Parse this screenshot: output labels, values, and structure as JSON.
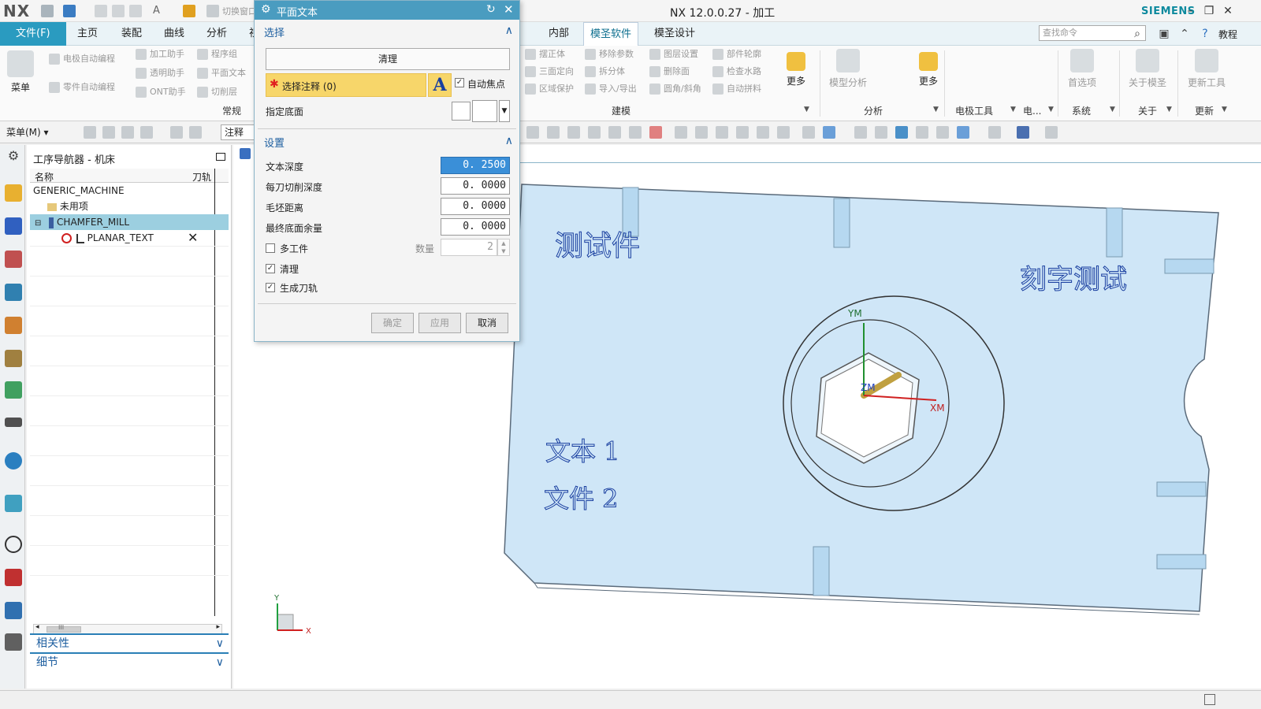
{
  "app": {
    "logo": "NX",
    "title": "NX 12.0.0.27 - 加工",
    "brand": "SIEMENS"
  },
  "quick_access": {
    "switch_window_label": "切换窗口"
  },
  "tabs": {
    "file": "文件(F)",
    "items": [
      "主页",
      "装配",
      "曲线",
      "分析",
      "视"
    ],
    "right_items": [
      "内部",
      "模圣软件",
      "模圣设计"
    ],
    "active": "模圣软件"
  },
  "search": {
    "placeholder": "查找命令"
  },
  "help_label": "教程",
  "ribbon": {
    "menu_big": "菜单",
    "group1": {
      "items": [
        "电极自动编程",
        "加工助手",
        "程序组",
        "透明助手",
        "平面文本",
        "零件自动编程",
        "ONT助手",
        "切削层"
      ],
      "label": "常规"
    },
    "group2": {
      "items": [
        "摆正体",
        "移除参数",
        "图层设置",
        "部件轮廓",
        "三面定向",
        "拆分体",
        "删除面",
        "检查水路",
        "区域保护",
        "导入/导出",
        "圆角/斜角",
        "自动拼料"
      ],
      "more": "更多",
      "label": "建模"
    },
    "group3": {
      "big": "模型分析",
      "more": "更多",
      "label": "分析"
    },
    "group4": {
      "label": "电极工具"
    },
    "group5": {
      "label": "电..."
    },
    "group6": {
      "big": "首选项",
      "label": "系统"
    },
    "group7": {
      "big": "关于模圣",
      "label": "关于"
    },
    "group8": {
      "big": "更新工具",
      "label": "更新"
    }
  },
  "toolbar2": {
    "menu_label": "菜单(M)",
    "filter_value": "注释"
  },
  "navigator": {
    "title": "工序导航器 - 机床",
    "col_name": "名称",
    "col_path": "刀轨",
    "rows": [
      {
        "label": "GENERIC_MACHINE",
        "selected": false
      },
      {
        "label": "未用项",
        "selected": false
      },
      {
        "label": "CHAMFER_MILL",
        "selected": true
      },
      {
        "label": "PLANAR_TEXT",
        "selected": false,
        "path_status": "✕"
      }
    ],
    "scroll_grip": "III",
    "accordion": [
      "相关性",
      "细节"
    ]
  },
  "dialog": {
    "title": "平面文本",
    "section_select": "选择",
    "clear_button": "清理",
    "select_notes": "选择注释 (0)",
    "auto_focus": "自动焦点",
    "auto_focus_checked": true,
    "specify_floor": "指定底面",
    "section_settings": "设置",
    "fields": [
      {
        "label": "文本深度",
        "value": "0. 2500",
        "active": true
      },
      {
        "label": "每刀切削深度",
        "value": "0. 0000",
        "active": false
      },
      {
        "label": "毛坯距离",
        "value": "0. 0000",
        "active": false
      },
      {
        "label": "最终底面余量",
        "value": "0. 0000",
        "active": false
      }
    ],
    "multi_part": {
      "label": "多工件",
      "checked": false
    },
    "quantity": {
      "label": "数量",
      "value": "2"
    },
    "clean": {
      "label": "清理",
      "checked": true
    },
    "gen_path": {
      "label": "生成刀轨",
      "checked": true
    },
    "buttons": {
      "ok": "确定",
      "apply": "应用",
      "cancel": "取消"
    }
  },
  "viewport": {
    "texts": [
      "测试件",
      "刻字测试",
      "文本 1",
      "文件 2"
    ],
    "axes": {
      "ym": "YM",
      "xm": "XM",
      "zm": "ZM",
      "tri_x": "X",
      "tri_y": "Y"
    }
  },
  "colors": {
    "accent": "#2a9bc0",
    "part_fill": "#cfe6f7",
    "selection": "#9ccfe0",
    "brand": "#0e8a9e"
  }
}
